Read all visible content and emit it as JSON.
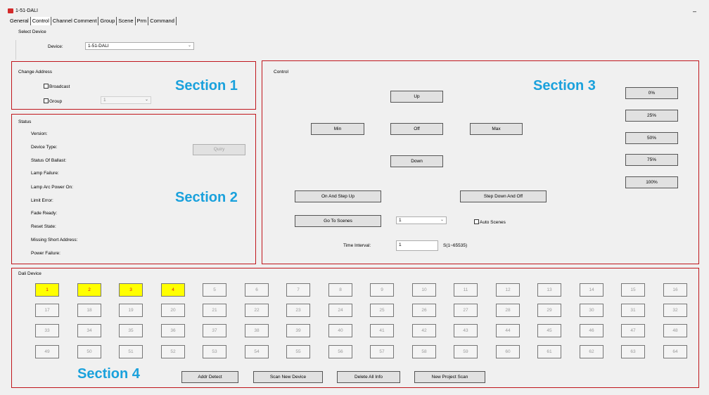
{
  "window": {
    "title": "1-51-DALI",
    "minimize_glyph": "–"
  },
  "tabs": [
    "General",
    "Control",
    "Channel Comment",
    "Group",
    "Scene",
    "Prm",
    "Command"
  ],
  "select_device": {
    "title": "Select Device",
    "device_label": "Device:",
    "device_value": "1-51-DALI"
  },
  "section_labels": {
    "s1": "Section 1",
    "s2": "Section 2",
    "s3": "Section 3",
    "s4": "Section 4"
  },
  "change_address": {
    "title": "Change Address",
    "broadcast": "Broadcast",
    "group": "Group",
    "group_value": "1"
  },
  "status": {
    "title": "Status",
    "query": "Quiry",
    "items": [
      "Version:",
      "Device Type:",
      "Status Of Ballast:",
      "Lamp Failure:",
      "Lamp Arc Power On:",
      "Limit Error:",
      "Fade Ready:",
      "Reset State:",
      "Missing Short Address:",
      "Power Failure:"
    ]
  },
  "control": {
    "title": "Control",
    "up": "Up",
    "min": "Min",
    "off": "Off",
    "max": "Max",
    "down": "Down",
    "on_step_up": "On And Step Up",
    "step_down_off": "Step Down And Off",
    "go_to_scenes": "Go To Scenes",
    "scene_value": "1",
    "auto_scenes": "Auto Scenes",
    "time_interval_label": "Time Interval:",
    "time_interval_value": "1",
    "time_interval_unit": "S(1~65535)",
    "percent_buttons": [
      "0%",
      "25%",
      "50%",
      "75%",
      "100%"
    ]
  },
  "dali_device": {
    "title": "Dali Device",
    "devices": [
      "1",
      "2",
      "3",
      "4",
      "5",
      "6",
      "7",
      "8",
      "9",
      "10",
      "11",
      "12",
      "13",
      "14",
      "15",
      "16",
      "17",
      "18",
      "19",
      "20",
      "21",
      "22",
      "23",
      "24",
      "25",
      "26",
      "27",
      "28",
      "29",
      "30",
      "31",
      "32",
      "33",
      "34",
      "35",
      "36",
      "37",
      "38",
      "39",
      "40",
      "41",
      "42",
      "43",
      "44",
      "45",
      "46",
      "47",
      "48",
      "49",
      "50",
      "51",
      "52",
      "53",
      "54",
      "55",
      "56",
      "57",
      "58",
      "59",
      "60",
      "61",
      "62",
      "63",
      "64"
    ],
    "active": [
      "1",
      "2",
      "3",
      "4"
    ],
    "active_bg": "#ffff00",
    "active_fg": "#d8141c",
    "buttons": {
      "addr_detect": "Addr Detect",
      "scan_new": "Scan New Device",
      "delete_all": "Delete All Info",
      "new_project_scan": "New Project Scan"
    }
  },
  "colors": {
    "highlight_box": "#c0161c",
    "section_label": "#1aa1dc"
  }
}
